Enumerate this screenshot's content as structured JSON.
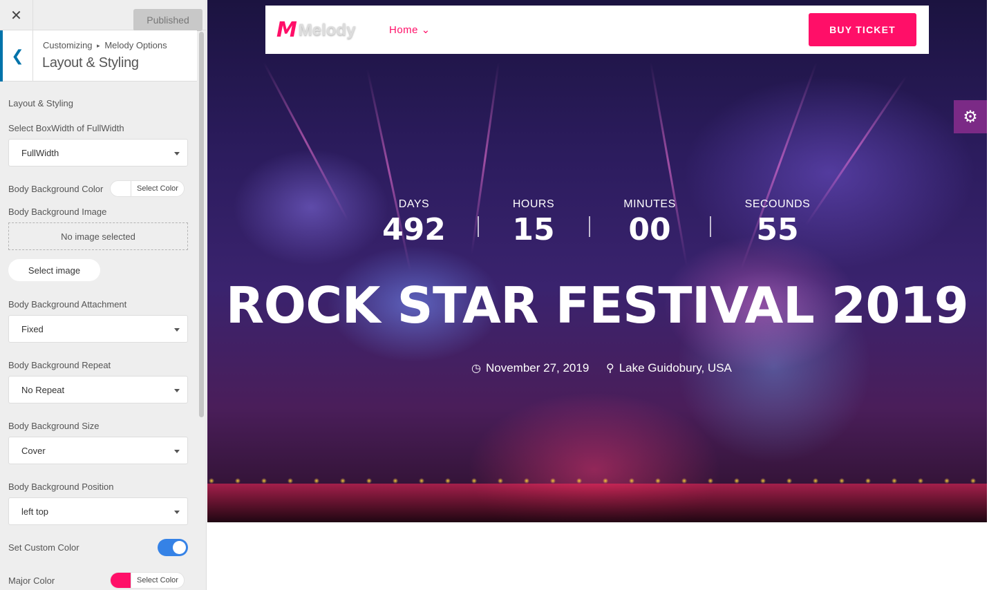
{
  "sidebar": {
    "close_glyph": "✕",
    "published_label": "Published",
    "back_glyph": "❮",
    "breadcrumb": {
      "root": "Customizing",
      "sep": "▸",
      "section": "Melody Options"
    },
    "title": "Layout & Styling",
    "section_heading": "Layout & Styling",
    "box_width": {
      "label": "Select BoxWidth of FullWidth",
      "value": "FullWidth"
    },
    "bg_color": {
      "label": "Body Background Color",
      "button": "Select Color",
      "color": "#ffffff"
    },
    "bg_image": {
      "label": "Body Background Image",
      "status": "No image selected",
      "button": "Select image"
    },
    "bg_attachment": {
      "label": "Body Background Attachment",
      "value": "Fixed"
    },
    "bg_repeat": {
      "label": "Body Background Repeat",
      "value": "No Repeat"
    },
    "bg_size": {
      "label": "Body Background Size",
      "value": "Cover"
    },
    "bg_position": {
      "label": "Body Background Position",
      "value": "left top"
    },
    "custom_color": {
      "label": "Set Custom Color",
      "enabled": true
    },
    "major_color": {
      "label": "Major Color",
      "button": "Select Color",
      "color": "#ff0f68"
    }
  },
  "preview": {
    "logo": {
      "mark": "M",
      "word": "Melody"
    },
    "nav": {
      "home": "Home ⌄"
    },
    "buy_ticket": "BUY TICKET",
    "gear_glyph": "⚙",
    "countdown": [
      {
        "label": "DAYS",
        "value": "492"
      },
      {
        "label": "HOURS",
        "value": "15"
      },
      {
        "label": "MINUTES",
        "value": "00"
      },
      {
        "label": "SECOUNDS",
        "value": "55"
      }
    ],
    "title": "ROCK STAR FESTIVAL 2019",
    "date": "November 27, 2019",
    "location": "Lake Guidobury, USA",
    "clock_glyph": "◷",
    "pin_glyph": "⚲",
    "accent_color": "#ff0f68"
  }
}
